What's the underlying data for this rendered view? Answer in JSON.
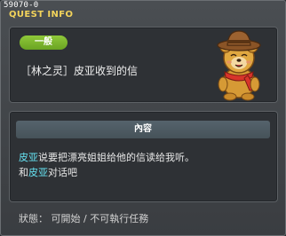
{
  "window": {
    "quest_id": "59070-0",
    "title": "QUEST INFO"
  },
  "summary": {
    "category_badge": "一般",
    "quest_name": "［林之灵］皮亚收到的信",
    "npc_icon": "bear-npc-icon"
  },
  "details": {
    "section_title": "內容",
    "line1": {
      "npc": "皮亚",
      "text": "说要把漂亮姐姐给他的信读给我听。"
    },
    "line2": {
      "prefix": "和",
      "npc": "皮亚",
      "suffix": "对话吧"
    }
  },
  "status": {
    "text": "狀態： 可開始 / 不可執行任務"
  },
  "colors": {
    "title": "#f2d35b",
    "badge": "#7ab52c",
    "highlight": "#66e2f2"
  }
}
